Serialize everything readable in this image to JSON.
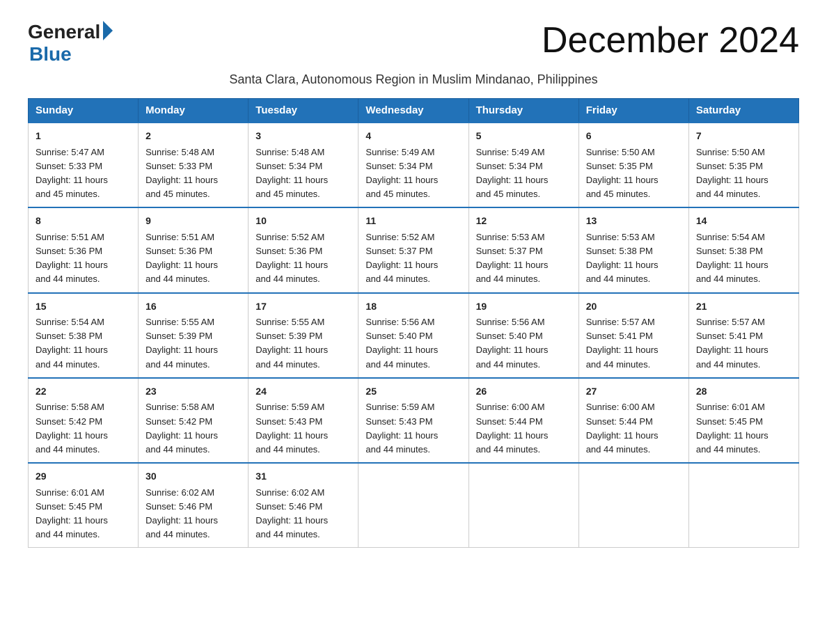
{
  "logo": {
    "general": "General",
    "blue": "Blue"
  },
  "title": "December 2024",
  "subtitle": "Santa Clara, Autonomous Region in Muslim Mindanao, Philippines",
  "days_of_week": [
    "Sunday",
    "Monday",
    "Tuesday",
    "Wednesday",
    "Thursday",
    "Friday",
    "Saturday"
  ],
  "weeks": [
    [
      {
        "day": "1",
        "sunrise": "Sunrise: 5:47 AM",
        "sunset": "Sunset: 5:33 PM",
        "daylight": "Daylight: 11 hours and 45 minutes."
      },
      {
        "day": "2",
        "sunrise": "Sunrise: 5:48 AM",
        "sunset": "Sunset: 5:33 PM",
        "daylight": "Daylight: 11 hours and 45 minutes."
      },
      {
        "day": "3",
        "sunrise": "Sunrise: 5:48 AM",
        "sunset": "Sunset: 5:34 PM",
        "daylight": "Daylight: 11 hours and 45 minutes."
      },
      {
        "day": "4",
        "sunrise": "Sunrise: 5:49 AM",
        "sunset": "Sunset: 5:34 PM",
        "daylight": "Daylight: 11 hours and 45 minutes."
      },
      {
        "day": "5",
        "sunrise": "Sunrise: 5:49 AM",
        "sunset": "Sunset: 5:34 PM",
        "daylight": "Daylight: 11 hours and 45 minutes."
      },
      {
        "day": "6",
        "sunrise": "Sunrise: 5:50 AM",
        "sunset": "Sunset: 5:35 PM",
        "daylight": "Daylight: 11 hours and 45 minutes."
      },
      {
        "day": "7",
        "sunrise": "Sunrise: 5:50 AM",
        "sunset": "Sunset: 5:35 PM",
        "daylight": "Daylight: 11 hours and 44 minutes."
      }
    ],
    [
      {
        "day": "8",
        "sunrise": "Sunrise: 5:51 AM",
        "sunset": "Sunset: 5:36 PM",
        "daylight": "Daylight: 11 hours and 44 minutes."
      },
      {
        "day": "9",
        "sunrise": "Sunrise: 5:51 AM",
        "sunset": "Sunset: 5:36 PM",
        "daylight": "Daylight: 11 hours and 44 minutes."
      },
      {
        "day": "10",
        "sunrise": "Sunrise: 5:52 AM",
        "sunset": "Sunset: 5:36 PM",
        "daylight": "Daylight: 11 hours and 44 minutes."
      },
      {
        "day": "11",
        "sunrise": "Sunrise: 5:52 AM",
        "sunset": "Sunset: 5:37 PM",
        "daylight": "Daylight: 11 hours and 44 minutes."
      },
      {
        "day": "12",
        "sunrise": "Sunrise: 5:53 AM",
        "sunset": "Sunset: 5:37 PM",
        "daylight": "Daylight: 11 hours and 44 minutes."
      },
      {
        "day": "13",
        "sunrise": "Sunrise: 5:53 AM",
        "sunset": "Sunset: 5:38 PM",
        "daylight": "Daylight: 11 hours and 44 minutes."
      },
      {
        "day": "14",
        "sunrise": "Sunrise: 5:54 AM",
        "sunset": "Sunset: 5:38 PM",
        "daylight": "Daylight: 11 hours and 44 minutes."
      }
    ],
    [
      {
        "day": "15",
        "sunrise": "Sunrise: 5:54 AM",
        "sunset": "Sunset: 5:38 PM",
        "daylight": "Daylight: 11 hours and 44 minutes."
      },
      {
        "day": "16",
        "sunrise": "Sunrise: 5:55 AM",
        "sunset": "Sunset: 5:39 PM",
        "daylight": "Daylight: 11 hours and 44 minutes."
      },
      {
        "day": "17",
        "sunrise": "Sunrise: 5:55 AM",
        "sunset": "Sunset: 5:39 PM",
        "daylight": "Daylight: 11 hours and 44 minutes."
      },
      {
        "day": "18",
        "sunrise": "Sunrise: 5:56 AM",
        "sunset": "Sunset: 5:40 PM",
        "daylight": "Daylight: 11 hours and 44 minutes."
      },
      {
        "day": "19",
        "sunrise": "Sunrise: 5:56 AM",
        "sunset": "Sunset: 5:40 PM",
        "daylight": "Daylight: 11 hours and 44 minutes."
      },
      {
        "day": "20",
        "sunrise": "Sunrise: 5:57 AM",
        "sunset": "Sunset: 5:41 PM",
        "daylight": "Daylight: 11 hours and 44 minutes."
      },
      {
        "day": "21",
        "sunrise": "Sunrise: 5:57 AM",
        "sunset": "Sunset: 5:41 PM",
        "daylight": "Daylight: 11 hours and 44 minutes."
      }
    ],
    [
      {
        "day": "22",
        "sunrise": "Sunrise: 5:58 AM",
        "sunset": "Sunset: 5:42 PM",
        "daylight": "Daylight: 11 hours and 44 minutes."
      },
      {
        "day": "23",
        "sunrise": "Sunrise: 5:58 AM",
        "sunset": "Sunset: 5:42 PM",
        "daylight": "Daylight: 11 hours and 44 minutes."
      },
      {
        "day": "24",
        "sunrise": "Sunrise: 5:59 AM",
        "sunset": "Sunset: 5:43 PM",
        "daylight": "Daylight: 11 hours and 44 minutes."
      },
      {
        "day": "25",
        "sunrise": "Sunrise: 5:59 AM",
        "sunset": "Sunset: 5:43 PM",
        "daylight": "Daylight: 11 hours and 44 minutes."
      },
      {
        "day": "26",
        "sunrise": "Sunrise: 6:00 AM",
        "sunset": "Sunset: 5:44 PM",
        "daylight": "Daylight: 11 hours and 44 minutes."
      },
      {
        "day": "27",
        "sunrise": "Sunrise: 6:00 AM",
        "sunset": "Sunset: 5:44 PM",
        "daylight": "Daylight: 11 hours and 44 minutes."
      },
      {
        "day": "28",
        "sunrise": "Sunrise: 6:01 AM",
        "sunset": "Sunset: 5:45 PM",
        "daylight": "Daylight: 11 hours and 44 minutes."
      }
    ],
    [
      {
        "day": "29",
        "sunrise": "Sunrise: 6:01 AM",
        "sunset": "Sunset: 5:45 PM",
        "daylight": "Daylight: 11 hours and 44 minutes."
      },
      {
        "day": "30",
        "sunrise": "Sunrise: 6:02 AM",
        "sunset": "Sunset: 5:46 PM",
        "daylight": "Daylight: 11 hours and 44 minutes."
      },
      {
        "day": "31",
        "sunrise": "Sunrise: 6:02 AM",
        "sunset": "Sunset: 5:46 PM",
        "daylight": "Daylight: 11 hours and 44 minutes."
      },
      null,
      null,
      null,
      null
    ]
  ]
}
